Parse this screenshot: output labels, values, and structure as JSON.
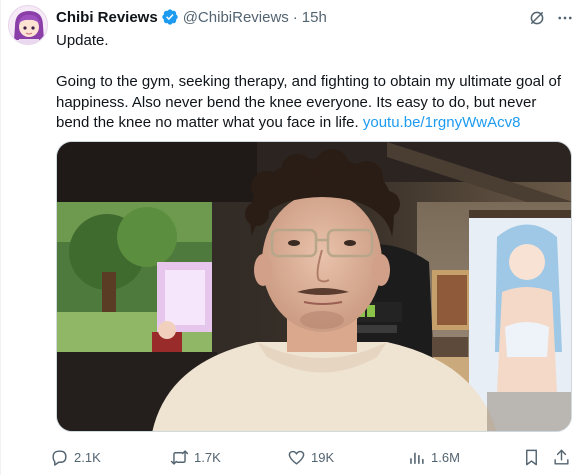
{
  "tweet": {
    "display_name": "Chibi Reviews",
    "handle": "@ChibiReviews",
    "separator": "·",
    "time": "15h",
    "text_line1": "Update.",
    "text_body": "Going to the gym, seeking therapy, and fighting to obtain my ultimate goal of happiness.  Also never bend the knee everyone. Its easy to do, but never bend the knee no matter what you face in life. ",
    "link_text": "youtu.be/1rgnyWwAcv8",
    "more_label": "···"
  },
  "actions": {
    "replies": "2.1K",
    "reposts": "1.7K",
    "likes": "19K",
    "views": "1.6M"
  },
  "colors": {
    "accent": "#1d9bf0",
    "secondary_text": "#536471",
    "primary_text": "#0f1419",
    "verified": "#1d9bf0"
  },
  "icons": {
    "verified": "verified-badge-icon",
    "grok": "grok-icon",
    "more": "more-icon",
    "reply": "reply-icon",
    "repost": "repost-icon",
    "like": "heart-icon",
    "views": "views-icon",
    "bookmark": "bookmark-icon",
    "share": "share-icon"
  }
}
